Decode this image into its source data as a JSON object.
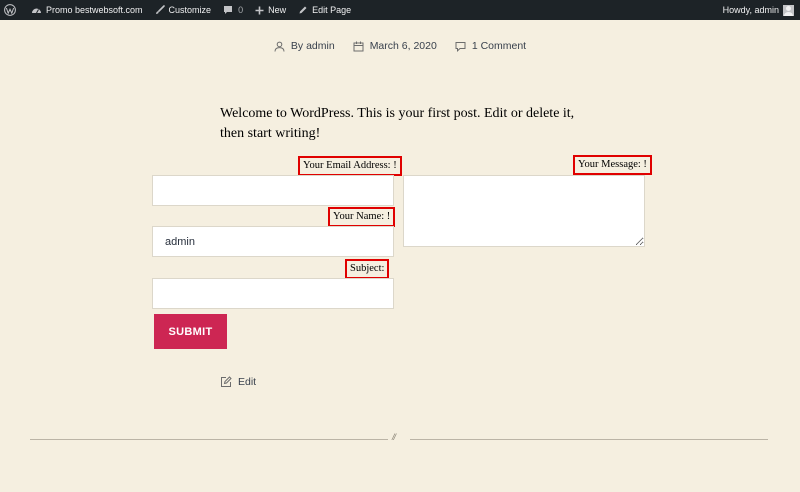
{
  "adminbar": {
    "site_name": "Promo bestwebsoft.com",
    "customize": "Customize",
    "comments_count": "0",
    "new": "New",
    "edit_page": "Edit Page",
    "howdy": "Howdy, admin"
  },
  "meta": {
    "author": "By admin",
    "date": "March 6, 2020",
    "comments": "1 Comment"
  },
  "content": {
    "intro": "Welcome to WordPress. This is your first post. Edit or delete it, then start writing!"
  },
  "form": {
    "email_label": "Your Email Address: !",
    "email_value": "",
    "name_label": "Your Name: !",
    "name_value": "admin",
    "subject_label": "Subject:",
    "subject_value": "",
    "message_label": "Your Message: !",
    "message_value": "",
    "submit_label": "SUBMIT"
  },
  "edit_link": "Edit",
  "separator_text": "//",
  "colors": {
    "background": "#f5efe0",
    "adminbar": "#1d2327",
    "accent": "#cd2653",
    "highlight_border": "#e00000"
  }
}
